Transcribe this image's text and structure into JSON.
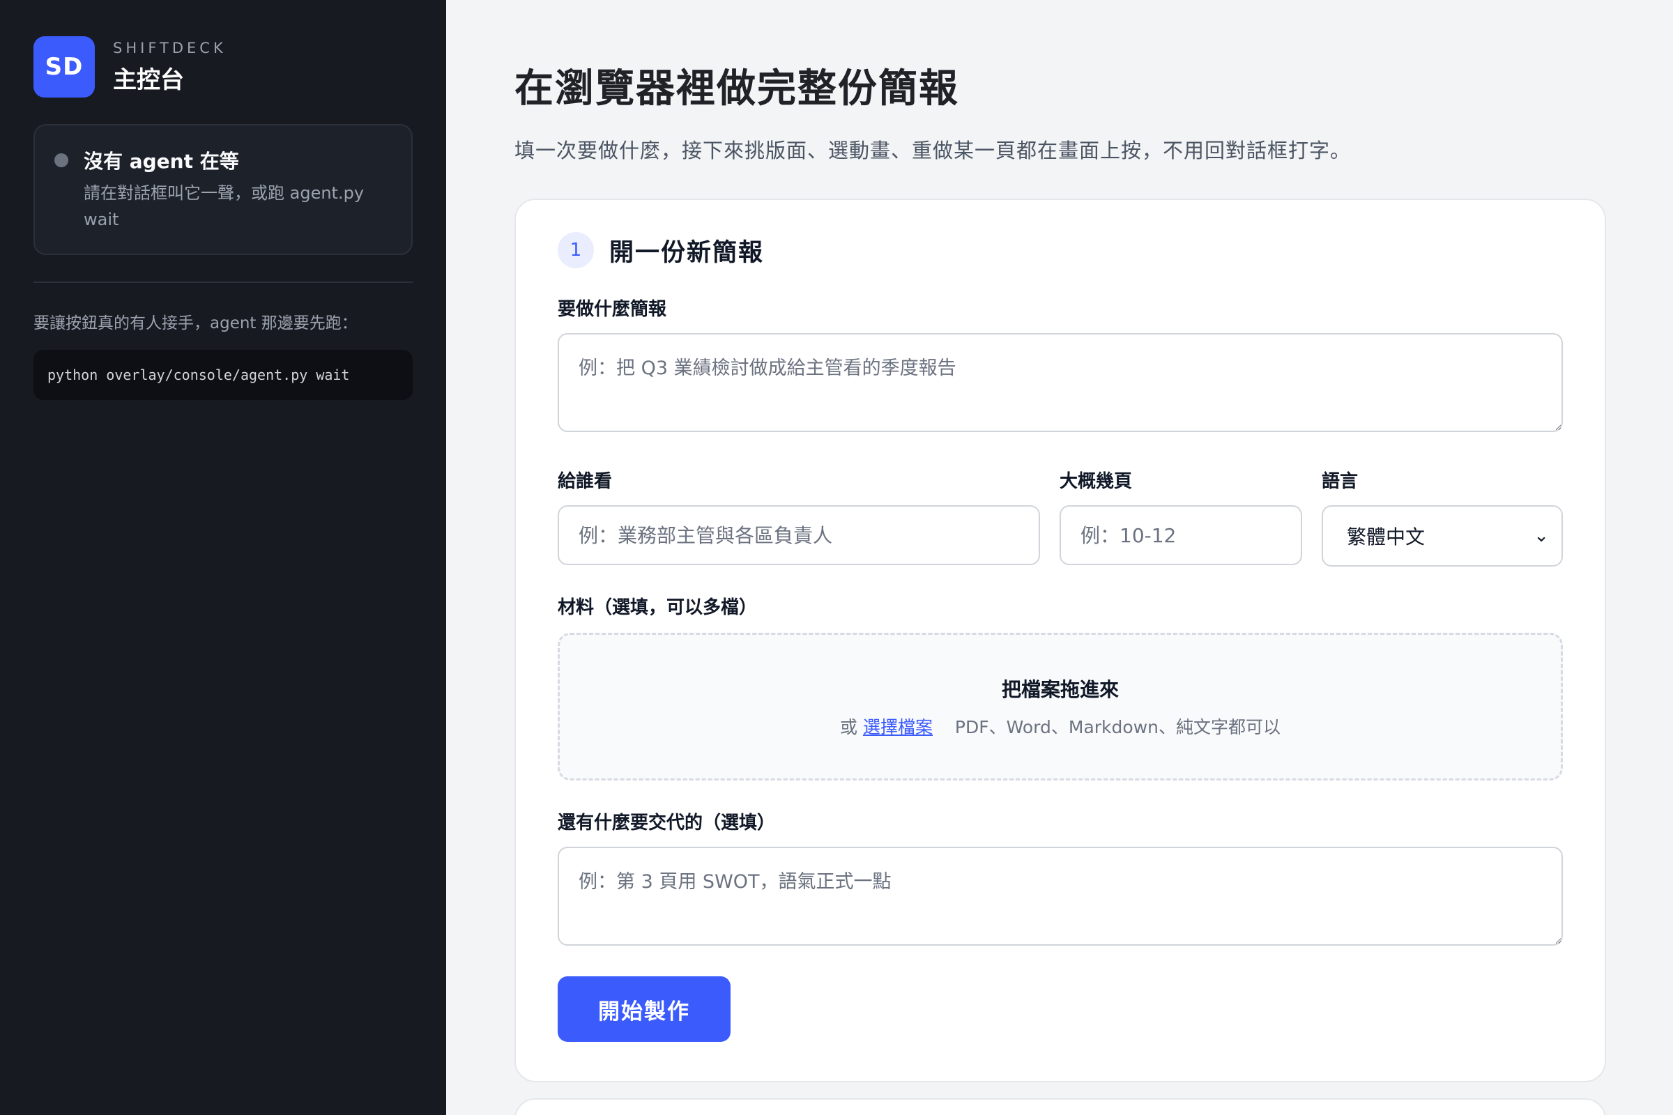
{
  "sidebar": {
    "logo": "SD",
    "eyebrow": "SHIFTDECK",
    "title": "主控台",
    "status": {
      "title": "沒有 agent 在等",
      "desc": "請在對話框叫它一聲，或跑 agent.py wait"
    },
    "note": "要讓按鈕真的有人接手，agent 那邊要先跑：",
    "command": "python overlay/console/agent.py wait"
  },
  "main": {
    "title": "在瀏覽器裡做完整份簡報",
    "subtitle": "填一次要做什麼，接下來挑版面、選動畫、重做某一頁都在畫面上按，不用回對話框打字。"
  },
  "card": {
    "step": "1",
    "title": "開一份新簡報",
    "topic": {
      "label": "要做什麼簡報",
      "placeholder": "例：把 Q3 業績檢討做成給主管看的季度報告"
    },
    "audience": {
      "label": "給誰看",
      "placeholder": "例：業務部主管與各區負責人"
    },
    "pages": {
      "label": "大概幾頁",
      "placeholder": "例：10-12"
    },
    "language": {
      "label": "語言",
      "value": "繁體中文"
    },
    "materials": {
      "label": "材料（選填，可以多檔）",
      "drop_title": "把檔案拖進來",
      "or": "或",
      "choose": "選擇檔案",
      "formats": "PDF、Word、Markdown、純文字都可以"
    },
    "notes": {
      "label": "還有什麼要交代的（選填）",
      "placeholder": "例：第 3 頁用 SWOT，語氣正式一點"
    },
    "submit": "開始製作"
  }
}
